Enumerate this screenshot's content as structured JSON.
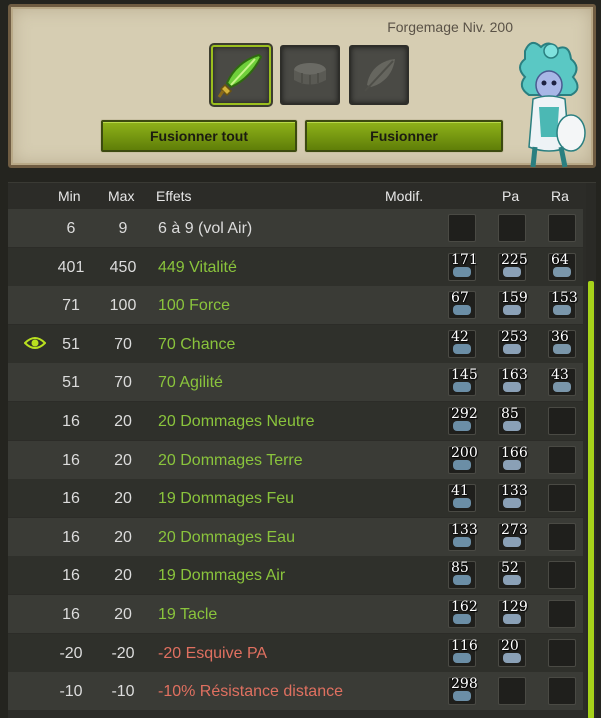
{
  "header": {
    "level_label": "Forgemage Niv. 200",
    "slots": [
      {
        "name": "weapon-slot",
        "icon": "green-sword-icon",
        "active": true
      },
      {
        "name": "rune-slot",
        "icon": "rune-placeholder-icon",
        "active": false
      },
      {
        "name": "feather-slot",
        "icon": "feather-placeholder-icon",
        "active": false
      }
    ],
    "buttons": {
      "merge_all": "Fusionner tout",
      "merge": "Fusionner"
    },
    "colors": {
      "accent": "#8fb31a",
      "panel": "#d6cdb2"
    }
  },
  "table": {
    "headers": {
      "min": "Min",
      "max": "Max",
      "effects": "Effets",
      "modif": "Modif.",
      "pa": "Pa",
      "ra": "Ra"
    },
    "rows": [
      {
        "min": "6",
        "max": "9",
        "effect": "6 à 9 (vol Air)",
        "kind": "neutral",
        "eye": false,
        "runes": [
          "",
          "",
          ""
        ]
      },
      {
        "min": "401",
        "max": "450",
        "effect": "449 Vitalité",
        "kind": "pos",
        "eye": false,
        "runes": [
          "171",
          "225",
          "64"
        ]
      },
      {
        "min": "71",
        "max": "100",
        "effect": "100 Force",
        "kind": "pos",
        "eye": false,
        "runes": [
          "67",
          "159",
          "153"
        ]
      },
      {
        "min": "51",
        "max": "70",
        "effect": "70 Chance",
        "kind": "pos",
        "eye": true,
        "runes": [
          "42",
          "253",
          "36"
        ]
      },
      {
        "min": "51",
        "max": "70",
        "effect": "70 Agilité",
        "kind": "pos",
        "eye": false,
        "runes": [
          "145",
          "163",
          "43"
        ]
      },
      {
        "min": "16",
        "max": "20",
        "effect": "20 Dommages Neutre",
        "kind": "pos",
        "eye": false,
        "runes": [
          "292",
          "85",
          ""
        ]
      },
      {
        "min": "16",
        "max": "20",
        "effect": "20 Dommages Terre",
        "kind": "pos",
        "eye": false,
        "runes": [
          "200",
          "166",
          ""
        ]
      },
      {
        "min": "16",
        "max": "20",
        "effect": "19 Dommages Feu",
        "kind": "pos",
        "eye": false,
        "runes": [
          "41",
          "133",
          ""
        ]
      },
      {
        "min": "16",
        "max": "20",
        "effect": "20 Dommages Eau",
        "kind": "pos",
        "eye": false,
        "runes": [
          "133",
          "273",
          ""
        ]
      },
      {
        "min": "16",
        "max": "20",
        "effect": "19 Dommages Air",
        "kind": "pos",
        "eye": false,
        "runes": [
          "85",
          "52",
          ""
        ]
      },
      {
        "min": "16",
        "max": "20",
        "effect": "19 Tacle",
        "kind": "pos",
        "eye": false,
        "runes": [
          "162",
          "129",
          ""
        ]
      },
      {
        "min": "-20",
        "max": "-20",
        "effect": "-20 Esquive PA",
        "kind": "neg",
        "eye": false,
        "runes": [
          "116",
          "20",
          ""
        ]
      },
      {
        "min": "-10",
        "max": "-10",
        "effect": "-10% Résistance distance",
        "kind": "neg",
        "eye": false,
        "runes": [
          "298",
          "",
          ""
        ]
      }
    ]
  }
}
